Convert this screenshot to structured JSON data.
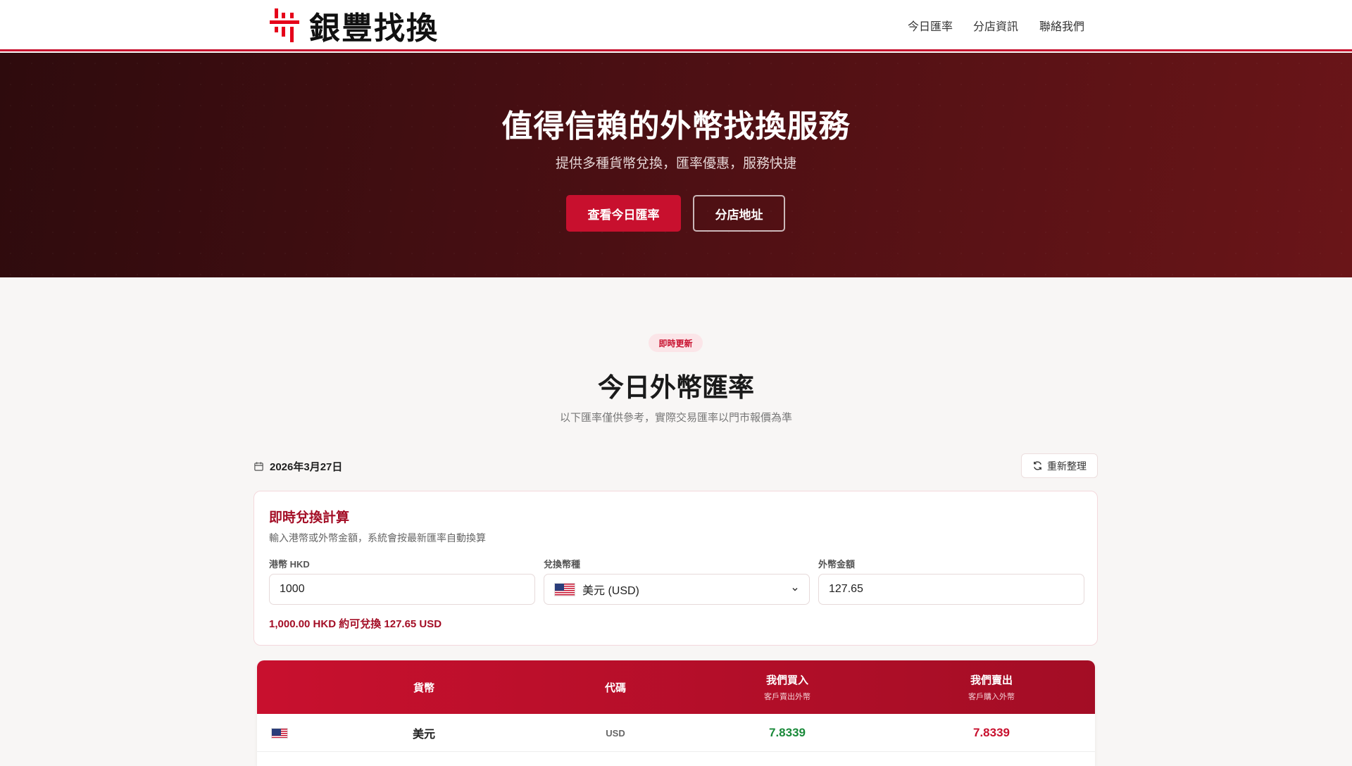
{
  "header": {
    "logo_text": "銀豐找換",
    "nav": [
      "今日匯率",
      "分店資訊",
      "聯絡我們"
    ]
  },
  "hero": {
    "title": "值得信賴的外幣找換服務",
    "subtitle": "提供多種貨幣兌換，匯率優惠，服務快捷",
    "primary_button": "查看今日匯率",
    "secondary_button": "分店地址"
  },
  "rates": {
    "badge": "即時更新",
    "title": "今日外幣匯率",
    "subtitle": "以下匯率僅供參考，實際交易匯率以門市報價為準",
    "date": "2026年3月27日",
    "refresh_label": "重新整理"
  },
  "calculator": {
    "title": "即時兌換計算",
    "description": "輸入港幣或外幣金額，系統會按最新匯率自動換算",
    "hkd_label": "港幣 HKD",
    "hkd_value": "1000",
    "currency_label": "兌換幣種",
    "currency_value": "美元 (USD)",
    "foreign_label": "外幣金額",
    "foreign_value": "127.65",
    "result": "1,000.00 HKD 約可兌換 127.65 USD"
  },
  "table": {
    "headers": {
      "currency": "貨幣",
      "code": "代碼",
      "buy": "我們買入",
      "buy_sub": "客戶賣出外幣",
      "sell": "我們賣出",
      "sell_sub": "客戶購入外幣"
    },
    "rows": [
      {
        "name": "美元",
        "code": "USD",
        "buy": "7.8339",
        "sell": "7.8339"
      }
    ]
  },
  "colors": {
    "brand": "#c8102e",
    "buy": "#1a8a3a",
    "sell": "#c8102e"
  }
}
